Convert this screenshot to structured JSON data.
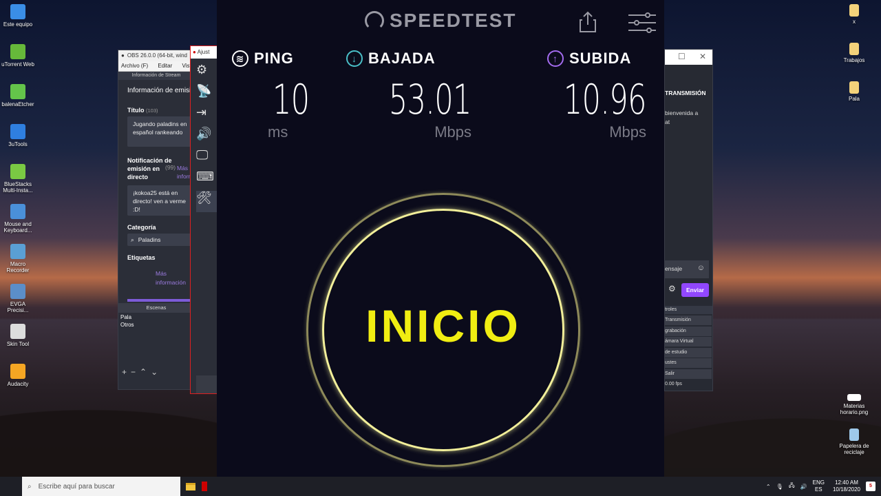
{
  "desktop_left": [
    {
      "name": "este-equipo",
      "label": "Este equipo",
      "color": "#3a8ee6"
    },
    {
      "name": "utorrent-web",
      "label": "uTorrent Web",
      "color": "#66b93a"
    },
    {
      "name": "balenaetcher",
      "label": "balenaEtcher",
      "color": "#64c44a"
    },
    {
      "name": "3utools",
      "label": "3uTools",
      "color": "#2f7fe0"
    },
    {
      "name": "bluestacks",
      "label": "BlueStacks Multi-Insta...",
      "color": "#7ac943"
    },
    {
      "name": "mouse-keyboard",
      "label": "Mouse and Keyboard...",
      "color": "#4a90d9"
    },
    {
      "name": "macro-recorder",
      "label": "Macro Recorder",
      "color": "#5a9fd4"
    },
    {
      "name": "evga-precision",
      "label": "EVGA Precisi...",
      "color": "#5b8ec9"
    },
    {
      "name": "skin-tool",
      "label": "Skin Tool",
      "color": "#dddddd"
    },
    {
      "name": "audacity",
      "label": "Audacity",
      "color": "#f5a623"
    }
  ],
  "desktop_right": [
    {
      "name": "x",
      "label": "x",
      "color": "#f3d27a"
    },
    {
      "name": "trabajos",
      "label": "Trabajos",
      "color": "#f3d27a"
    },
    {
      "name": "pala",
      "label": "Pala",
      "color": "#f3d27a"
    },
    {
      "name": "materias",
      "label": "Materias horario.png",
      "color": "#ffffff"
    },
    {
      "name": "papelera",
      "label": "Papelera de reciclaje",
      "color": "#9ec9ea"
    }
  ],
  "obs": {
    "title": "OBS 26.0.0 (64-bit, wind",
    "menu": [
      "Archivo (F)",
      "Editar",
      "Vista"
    ],
    "dock_title": "Información de Stream",
    "stream_info_heading": "Información de emisi",
    "title_label": "Título",
    "title_count": "(103)",
    "title_value": "Jugando paladins en español rankeando",
    "notif_label": "Notificación de emisión en directo",
    "notif_count": "(99)",
    "more_info": "Más información",
    "notif_value": "¡kokoa25 está en directo! ven a verme :D!",
    "category_label": "Categoría",
    "category_value": "Paladins",
    "tags_label": "Etiquetas",
    "scenes_title": "Escenas",
    "scenes": [
      "Pala",
      "Otros"
    ]
  },
  "ajustes": {
    "title": "Ajust"
  },
  "right_obs": {
    "chat_title": "TRANSMISIÓN",
    "chat_text": [
      "bienvenida a",
      "at"
    ],
    "message_placeholder": "ensaje",
    "send_label": "Enviar",
    "controls_title": "troles",
    "controls": [
      "Transmisión",
      "grabación",
      "ámara Virtual",
      "de estudio",
      "ustes",
      "Salir"
    ],
    "fps": "0.00 fps"
  },
  "speedtest": {
    "logo": "SPEEDTEST",
    "ping": {
      "label": "PING",
      "value": "10",
      "unit": "ms",
      "color": "#ffffff"
    },
    "download": {
      "label": "BAJADA",
      "value": "53.01",
      "unit": "Mbps",
      "color": "#4ac0c8"
    },
    "upload": {
      "label": "SUBIDA",
      "value": "10.96",
      "unit": "Mbps",
      "color": "#a46cf0"
    },
    "start_label": "INICIO"
  },
  "taskbar": {
    "search_placeholder": "Escribe aquí para buscar",
    "lang_top": "ENG",
    "lang_bottom": "ES",
    "time": "12:40 AM",
    "date": "10/18/2020",
    "notif_count": "5"
  }
}
